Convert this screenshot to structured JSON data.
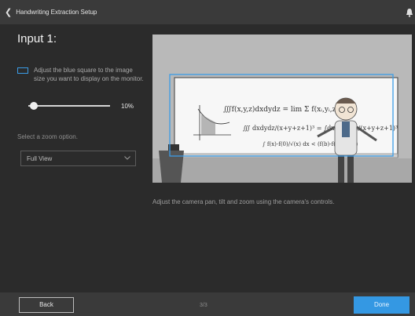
{
  "topbar": {
    "back_icon": "chevron-left",
    "title": "Handwriting Extraction Setup",
    "bell_icon": "bell"
  },
  "panel": {
    "heading": "Input 1:",
    "adjust_text": "Adjust the blue square to the image size you want to display on the monitor.",
    "slider_value_label": "10%",
    "slider_value": 10,
    "zoom_label": "Select a zoom option.",
    "zoom_selected": "Full View"
  },
  "preview": {
    "instructions": "Adjust the camera pan, tilt and zoom using the camera's controls."
  },
  "footer": {
    "back_label": "Back",
    "page_indicator": "3/3",
    "done_label": "Done"
  },
  "colors": {
    "accent": "#3498e3",
    "frame_blue": "#3b9ce6",
    "background": "#2b2b2b",
    "bar": "#3a3a3a"
  }
}
